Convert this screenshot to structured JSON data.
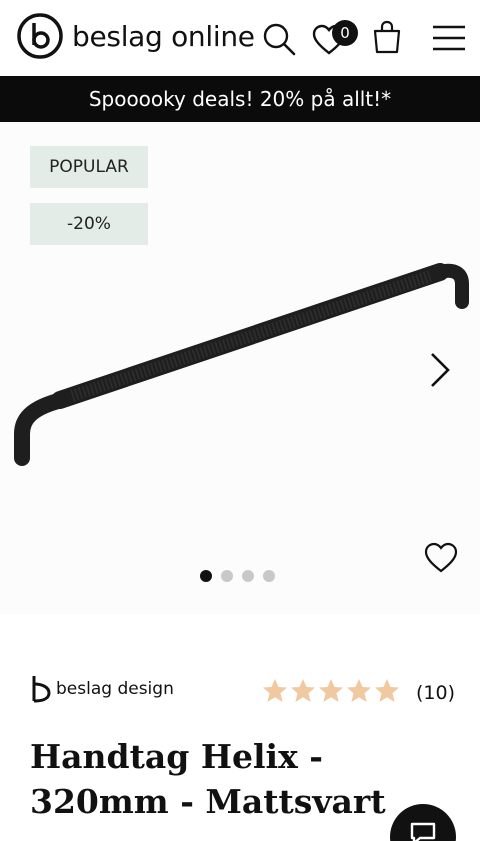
{
  "header": {
    "brand_name": "beslag online",
    "wishlist_count": "0",
    "icons": [
      "logo-icon",
      "search-icon",
      "heart-icon",
      "bag-icon",
      "menu-icon"
    ]
  },
  "promo": {
    "text": "Spooooky deals! 20% på allt!*"
  },
  "gallery": {
    "tags": [
      "POPULAR",
      "-20%"
    ],
    "slide_count": 4,
    "active_slide": 1
  },
  "product": {
    "brand": "beslag design",
    "rating": 5,
    "rating_count": "(10)",
    "title": "Handtag Helix - 320mm - Mattsvart"
  },
  "colors": {
    "promo_bg": "#0b0b0b",
    "tag_bg": "#e3ece6",
    "star": "#f0c9a0",
    "product": "#1e1e1e"
  }
}
